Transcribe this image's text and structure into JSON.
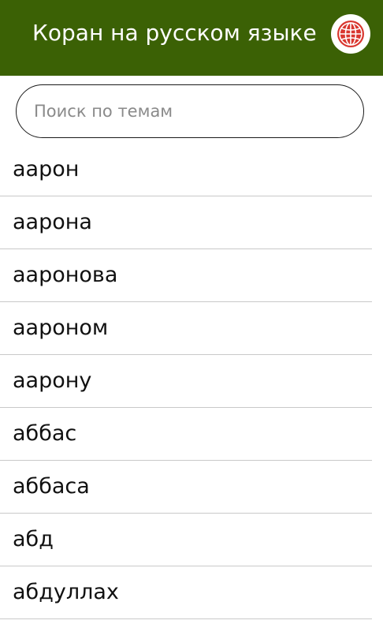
{
  "header": {
    "title": "Коран на русском языке",
    "language_icon": "globe-language-icon",
    "background_color": "#3b6105",
    "icon_color": "#d9362f"
  },
  "search": {
    "placeholder": "Поиск по темам",
    "value": ""
  },
  "topics": [
    {
      "label": "аарон"
    },
    {
      "label": "аарона"
    },
    {
      "label": "ааронова"
    },
    {
      "label": "аароном"
    },
    {
      "label": "аарону"
    },
    {
      "label": "аббас"
    },
    {
      "label": "аббаса"
    },
    {
      "label": "абд"
    },
    {
      "label": "абдуллах"
    }
  ]
}
